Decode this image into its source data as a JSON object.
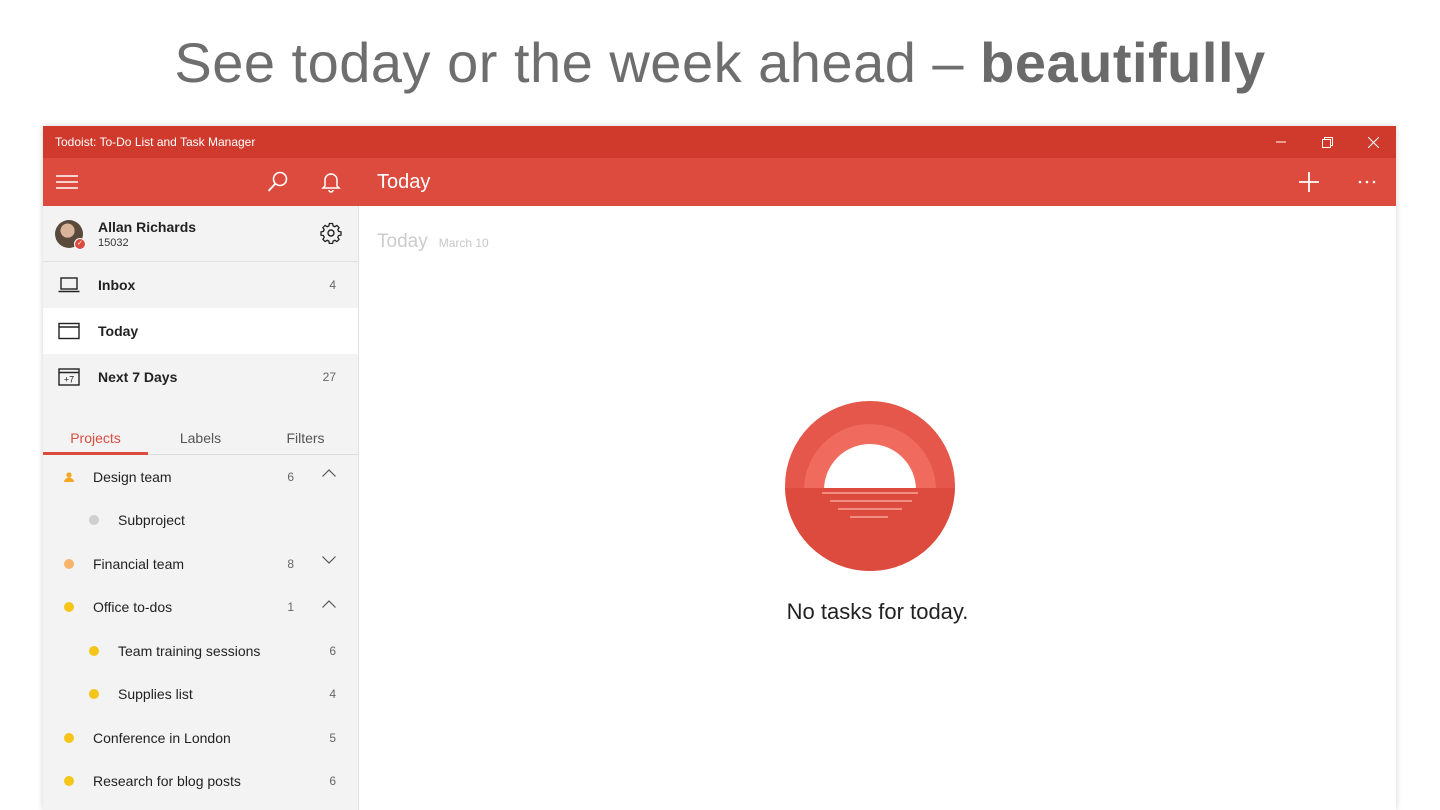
{
  "headline": {
    "normal": "See today or the week ahead – ",
    "bold": "beautifully"
  },
  "window": {
    "title": "Todoist: To-Do List and Task Manager",
    "accent": "#db4c3f",
    "titlebar_color": "#cf3a2c"
  },
  "appbar": {
    "title": "Today"
  },
  "user": {
    "name": "Allan Richards",
    "karma": "15032"
  },
  "nav": [
    {
      "label": "Inbox",
      "count": "4",
      "icon": "inbox-icon"
    },
    {
      "label": "Today",
      "count": "",
      "icon": "calendar-icon"
    },
    {
      "label": "Next 7 Days",
      "count": "27",
      "icon": "next-7-days-icon"
    }
  ],
  "tabs": [
    "Projects",
    "Labels",
    "Filters"
  ],
  "projects": [
    {
      "label": "Design team",
      "count": "6",
      "color": "#f5a623",
      "chevron": "up"
    },
    {
      "label": "Subproject",
      "count": "",
      "color": "#cfcfcf",
      "sub": true
    },
    {
      "label": "Financial team",
      "count": "8",
      "color": "#f7b56b",
      "chevron": "down"
    },
    {
      "label": "Office to-dos",
      "count": "1",
      "color": "#f5c518",
      "chevron": "up"
    },
    {
      "label": "Team training sessions",
      "count": "6",
      "color": "#f5c518",
      "sub": true
    },
    {
      "label": "Supplies list",
      "count": "4",
      "color": "#f5c518",
      "sub": true
    },
    {
      "label": "Conference in London",
      "count": "5",
      "color": "#f5c518"
    },
    {
      "label": "Research for blog posts",
      "count": "6",
      "color": "#f5c518"
    }
  ],
  "main": {
    "title": "Today",
    "date": "March 10",
    "empty_message": "No tasks for today."
  }
}
